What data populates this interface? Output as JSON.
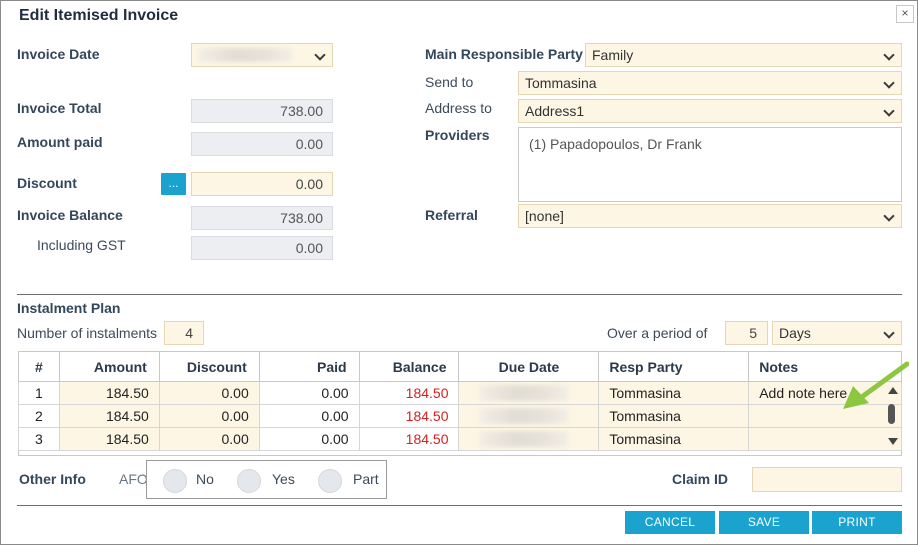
{
  "dialog": {
    "title": "Edit Itemised Invoice",
    "close_glyph": "×"
  },
  "left": {
    "invoice_date_label": "Invoice Date",
    "invoice_total_label": "Invoice Total",
    "invoice_total_value": "738.00",
    "amount_paid_label": "Amount paid",
    "amount_paid_value": "0.00",
    "discount_label": "Discount",
    "discount_button_label": "...",
    "discount_value": "0.00",
    "invoice_balance_label": "Invoice Balance",
    "invoice_balance_value": "738.00",
    "including_gst_label": "Including GST",
    "including_gst_value": "0.00"
  },
  "right": {
    "main_party_label": "Main Responsible Party",
    "main_party_value": "Family",
    "send_to_label": "Send to",
    "send_to_value": "Tommasina",
    "address_to_label": "Address to",
    "address_to_value": "Address1",
    "providers_label": "Providers",
    "providers_value": "(1) Papadopoulos, Dr Frank",
    "referral_label": "Referral",
    "referral_value": "[none]"
  },
  "instalment": {
    "section_label": "Instalment Plan",
    "number_label": "Number of instalments",
    "number_value": "4",
    "period_label": "Over a period of",
    "period_value": "5",
    "period_unit": "Days"
  },
  "grid": {
    "headers": [
      "#",
      "Amount",
      "Discount",
      "Paid",
      "Balance",
      "Due Date",
      "Resp Party",
      "Notes"
    ],
    "rows": [
      {
        "num": "1",
        "amount": "184.50",
        "discount": "0.00",
        "paid": "0.00",
        "balance": "184.50",
        "resp": "Tommasina",
        "notes": "Add note here"
      },
      {
        "num": "2",
        "amount": "184.50",
        "discount": "0.00",
        "paid": "0.00",
        "balance": "184.50",
        "resp": "Tommasina",
        "notes": ""
      },
      {
        "num": "3",
        "amount": "184.50",
        "discount": "0.00",
        "paid": "0.00",
        "balance": "184.50",
        "resp": "Tommasina",
        "notes": ""
      }
    ]
  },
  "other_info": {
    "label": "Other Info",
    "afo_label": "AFO",
    "options": [
      "No",
      "Yes",
      "Part"
    ],
    "claim_id_label": "Claim ID",
    "claim_id_value": ""
  },
  "buttons": {
    "cancel": "CANCEL",
    "save": "SAVE",
    "print": "PRINT"
  },
  "colors": {
    "accent": "#1aa3cf",
    "editable_bg": "#fdf6e4",
    "readonly_bg": "#eceef2",
    "balance_red": "#d61f1f",
    "annotation_arrow": "#8dc63f"
  }
}
